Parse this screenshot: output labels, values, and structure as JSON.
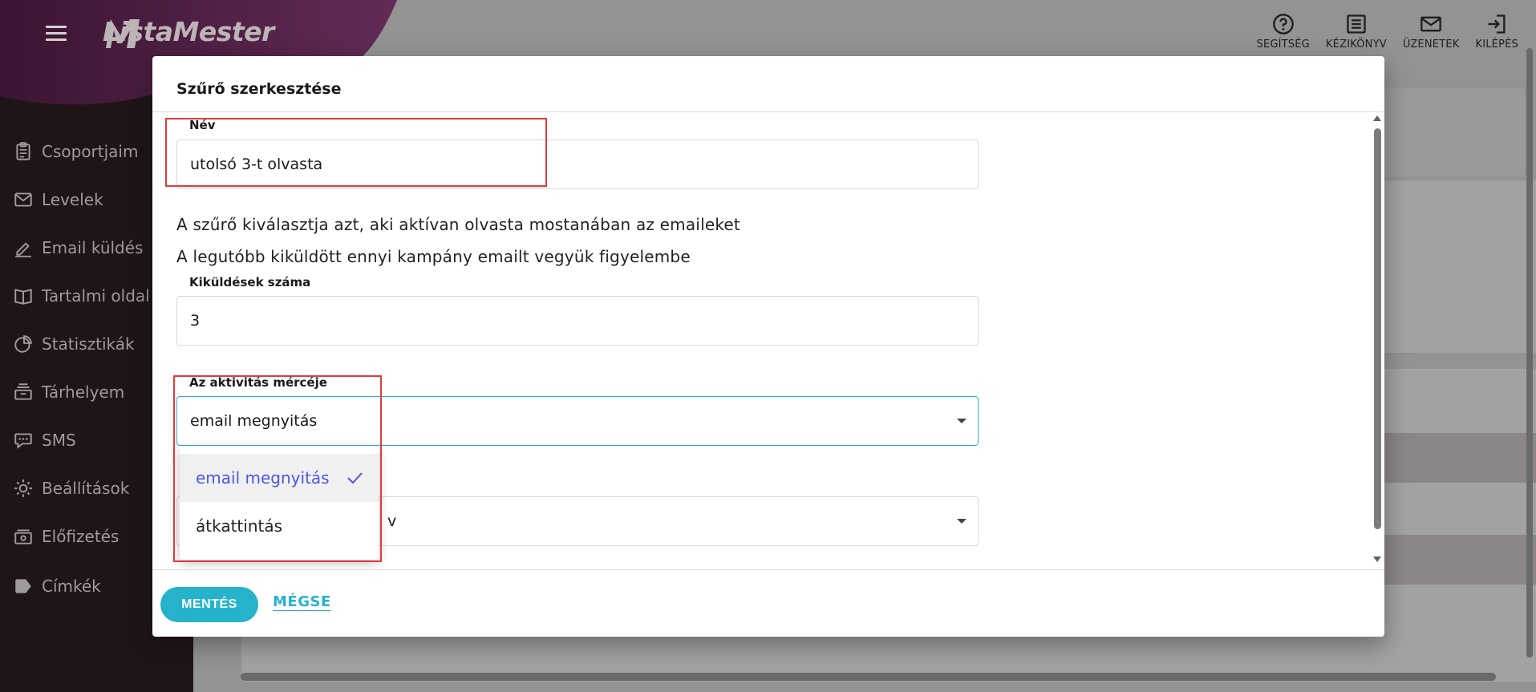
{
  "app": {
    "logo_text": "ListaMester",
    "colors": {
      "accent": "#25b3cc",
      "sidebar": "#1f1518",
      "brand_purple": "#6b2a63",
      "selected_option": "#4a57e8",
      "annotation": "#e23a3a"
    }
  },
  "sidebar": {
    "items": [
      {
        "label": "Csoportjaim",
        "icon": "clipboard-icon"
      },
      {
        "label": "Levelek",
        "icon": "envelope-icon"
      },
      {
        "label": "Email küldés",
        "icon": "pen-icon"
      },
      {
        "label": "Tartalmi oldal",
        "icon": "book-icon"
      },
      {
        "label": "Statisztikák",
        "icon": "pie-chart-icon"
      },
      {
        "label": "Tárhelyem",
        "icon": "archive-icon"
      },
      {
        "label": "SMS",
        "icon": "chat-icon"
      },
      {
        "label": "Beállítások",
        "icon": "gear-icon"
      },
      {
        "label": "Előfizetés",
        "icon": "money-icon"
      },
      {
        "label": "Címkék",
        "icon": "tag-icon"
      }
    ]
  },
  "topbar": {
    "actions": [
      {
        "label": "SEGÍTSÉG",
        "icon": "help-icon"
      },
      {
        "label": "KÉZIKÖNYV",
        "icon": "manual-icon"
      },
      {
        "label": "ÜZENETEK",
        "icon": "mail-icon"
      },
      {
        "label": "KILÉPÉS",
        "icon": "logout-icon"
      }
    ]
  },
  "dialog": {
    "title": "Szűrő szerkesztése",
    "name_field": {
      "label": "Név",
      "value": "utolsó 3-t olvasta"
    },
    "description_1": "A szűrő kiválasztja azt, aki aktívan olvasta mostanában az emaileket",
    "description_2": "A legutóbb kiküldött ennyi kampány emailt vegyük figyelembe",
    "count_field": {
      "label": "Kiküldések száma",
      "value": "3"
    },
    "measure_field": {
      "label": "Az aktivitás mércéje",
      "value": "email megnyitás",
      "options": [
        "email megnyitás",
        "átkattintás"
      ],
      "selected_index": 0
    },
    "hidden_select": {
      "visible_value_fragment": "v"
    },
    "save_label": "MENTÉS",
    "cancel_label": "MÉGSE"
  }
}
